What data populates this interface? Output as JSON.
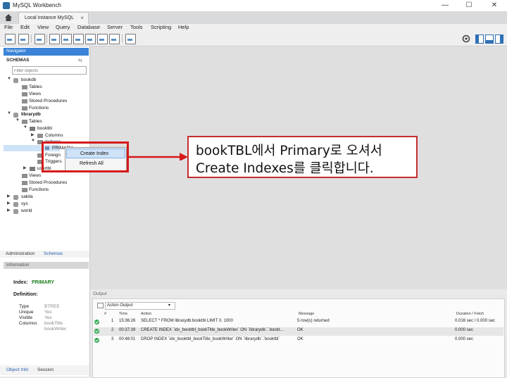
{
  "window": {
    "title": "MySQL Workbench",
    "controls": {
      "minimize": "—",
      "maximize": "☐",
      "close": "✕"
    }
  },
  "tabs": [
    {
      "label": "Local instance MySQL",
      "close": "×"
    }
  ],
  "menu": [
    "File",
    "Edit",
    "View",
    "Query",
    "Database",
    "Server",
    "Tools",
    "Scripting",
    "Help"
  ],
  "navigator": {
    "header": "Navigator",
    "schemas_label": "SCHEMAS",
    "filter_placeholder": "Filter objects",
    "tree": {
      "bookdb": "bookdb",
      "bookdb_tables": "Tables",
      "bookdb_views": "Views",
      "bookdb_procs": "Stored Procedures",
      "bookdb_funcs": "Functions",
      "librarydb": "librarydb",
      "lib_tables": "Tables",
      "booktbl": "booktbl",
      "columns": "Columns",
      "indexes": "Indexes",
      "primary": "PRIMARY",
      "foreign": "Foreign",
      "triggers": "Triggers",
      "usertbl": "usertbl",
      "lib_views": "Views",
      "lib_procs": "Stored Procedures",
      "lib_funcs": "Functions",
      "sakila": "sakila",
      "sys": "sys",
      "world": "world"
    },
    "tabs": [
      "Administration",
      "Schemas"
    ]
  },
  "information": {
    "header": "Information",
    "index_label": "Index:",
    "index_value": "PRIMARY",
    "definition_label": "Definition:",
    "type_label": "Type",
    "type_value": "BTREE",
    "unique_label": "Unique",
    "unique_value": "Yes",
    "visible_label": "Visible",
    "visible_value": "Yes",
    "columns_label": "Columns",
    "columns_values": [
      "bookTitle",
      "bookWriter"
    ],
    "bottom_tabs": [
      "Object Info",
      "Session"
    ]
  },
  "context_menu": {
    "items": [
      "Create Index",
      "Refresh All"
    ]
  },
  "output": {
    "header": "Output",
    "selector": "Action Output",
    "columns": [
      "#",
      "Time",
      "Action",
      "Message",
      "Duration / Fetch"
    ],
    "rows": [
      {
        "num": "1",
        "time": "15:36:26",
        "action": "SELECT * FROM librarydb.booktbl LIMIT 0, 1000",
        "message": "5 row(s) returned",
        "duration": "0.016 sec / 0.000 sec"
      },
      {
        "num": "2",
        "time": "00:37:39",
        "action": "CREATE INDEX `idx_booktbl_bookTitle_bookWriter` ON `librarydb`.`bookt...",
        "message": "OK",
        "duration": "0.000 sec"
      },
      {
        "num": "3",
        "time": "00:48:01",
        "action": "DROP INDEX `idx_booktbl_bookTitle_bookWriter` ON `librarydb`.`booktbl`",
        "message": "OK",
        "duration": "0.000 sec"
      }
    ]
  },
  "callout": {
    "line1": "bookTBL에서 Primary로 오셔서",
    "line2": "Create Indexes를 클릭합니다."
  },
  "colors": {
    "annotation_red": "#d61a1a",
    "nav_header": "#3a83d6",
    "success": "#2fa84f"
  }
}
